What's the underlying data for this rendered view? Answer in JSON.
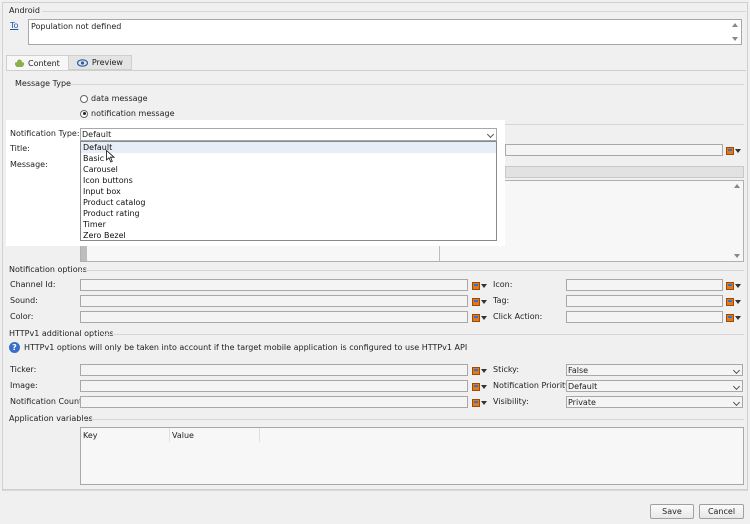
{
  "android": {
    "section_label": "Android",
    "to_link": "To",
    "population_text": "Population not defined"
  },
  "tabs": [
    {
      "label": "Content",
      "icon": "android-icon"
    },
    {
      "label": "Preview",
      "icon": "eye-icon"
    }
  ],
  "message_type": {
    "label": "Message Type",
    "options": [
      "data message",
      "notification message"
    ],
    "selected": "notification message"
  },
  "form": {
    "notification_type_label": "Notification Type:",
    "notification_type_value": "Default",
    "title_label": "Title:",
    "message_label": "Message:"
  },
  "dropdown": {
    "items": [
      "Default",
      "Basic",
      "Carousel",
      "Icon buttons",
      "Input box",
      "Product catalog",
      "Product rating",
      "Timer",
      "Zero Bezel"
    ]
  },
  "notification_options": {
    "label": "Notification options",
    "channel_id_label": "Channel Id:",
    "sound_label": "Sound:",
    "color_label": "Color:",
    "icon_label": "Icon:",
    "tag_label": "Tag:",
    "click_action_label": "Click Action:"
  },
  "httpv1": {
    "label": "HTTPv1 additional options",
    "info_text": "HTTPv1 options will only be taken into account if the target mobile application is configured to use HTTPv1 API",
    "ticker_label": "Ticker:",
    "image_label": "Image:",
    "notification_count_label": "Notification Count:",
    "sticky_label": "Sticky:",
    "sticky_value": "False",
    "priority_label": "Notification Priority:",
    "priority_value": "Default",
    "visibility_label": "Visibility:",
    "visibility_value": "Private"
  },
  "app_variables": {
    "label": "Application variables",
    "columns": [
      "Key",
      "Value"
    ]
  },
  "footer": {
    "save_label": "Save",
    "cancel_label": "Cancel"
  },
  "colors": {
    "accent": "#3a6fc9",
    "icon_orange": "#e07a1e",
    "android_green": "#8bb04a"
  }
}
